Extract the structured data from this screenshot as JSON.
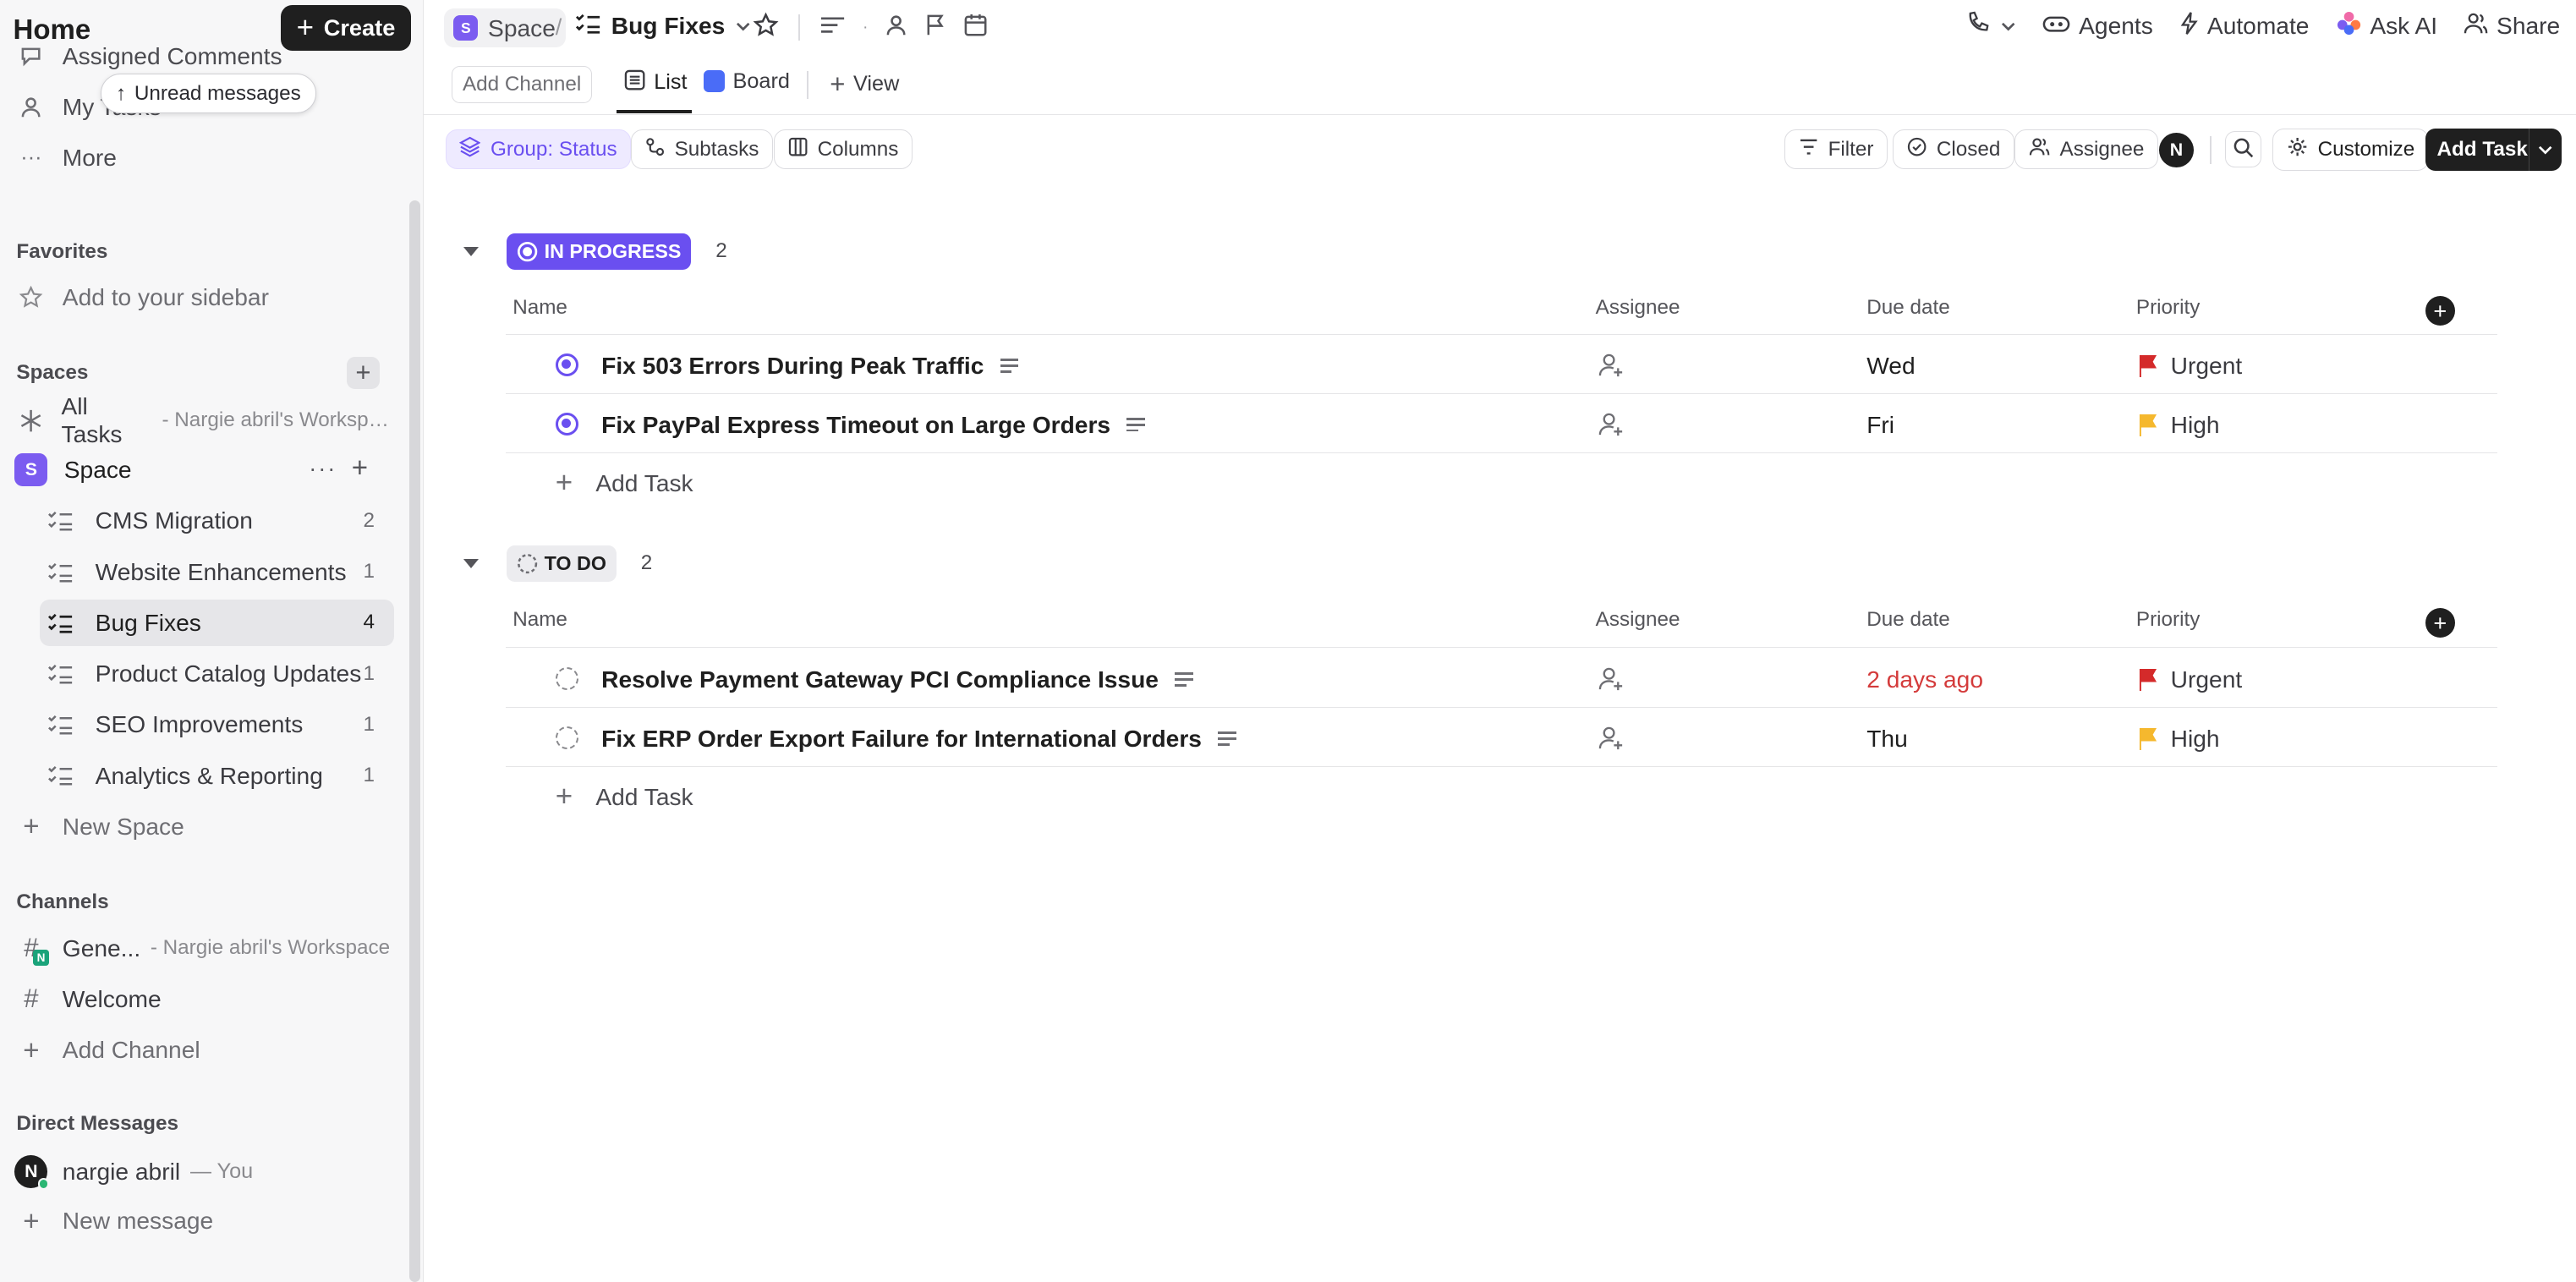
{
  "sidebar": {
    "title": "Home",
    "create_label": "Create",
    "top_items": [
      {
        "label": "Assigned Comments"
      },
      {
        "label": "My Tasks"
      },
      {
        "label": "More"
      }
    ],
    "unread_label": "Unread messages",
    "favorites": {
      "heading": "Favorites",
      "add_label": "Add to your sidebar"
    },
    "spaces": {
      "heading": "Spaces",
      "all_tasks": {
        "label": "All Tasks",
        "sub": "- Nargie abril's Workspace"
      },
      "space": {
        "badge": "S",
        "label": "Space"
      },
      "lists": [
        {
          "label": "CMS Migration",
          "count": "2"
        },
        {
          "label": "Website Enhancements",
          "count": "1"
        },
        {
          "label": "Bug Fixes",
          "count": "4"
        },
        {
          "label": "Product Catalog Updates",
          "count": "1"
        },
        {
          "label": "SEO Improvements",
          "count": "1"
        },
        {
          "label": "Analytics & Reporting",
          "count": "1"
        }
      ],
      "new_space_label": "New Space"
    },
    "channels": {
      "heading": "Channels",
      "items": [
        {
          "label": "Gene...",
          "sub": "- Nargie abril's Workspace"
        },
        {
          "label": "Welcome"
        }
      ],
      "add_label": "Add Channel"
    },
    "direct_messages": {
      "heading": "Direct Messages",
      "user": {
        "initial": "N",
        "name": "nargie abril",
        "suffix": "— You"
      },
      "new_label": "New message"
    }
  },
  "topbar": {
    "crumb_space": "Space",
    "crumb_separator": "/",
    "crumb_list": "Bug Fixes",
    "right": [
      {
        "label": "Agents",
        "icon": "agents-icon"
      },
      {
        "label": "Automate",
        "icon": "bolt-icon"
      },
      {
        "label": "Ask AI",
        "icon": "ai-icon"
      },
      {
        "label": "Share",
        "icon": "share-icon"
      }
    ]
  },
  "viewbar": {
    "add_channel": "Add Channel",
    "tabs": [
      {
        "label": "List",
        "active": true
      },
      {
        "label": "Board",
        "active": false
      }
    ],
    "add_view": "View"
  },
  "filters": {
    "group": "Group: Status",
    "subtasks": "Subtasks",
    "columns": "Columns",
    "filter": "Filter",
    "closed": "Closed",
    "assignee": "Assignee",
    "avatar": "N",
    "customize": "Customize",
    "add_task": "Add Task"
  },
  "columns": {
    "name": "Name",
    "assignee": "Assignee",
    "due": "Due date",
    "priority": "Priority"
  },
  "groups": [
    {
      "status": "IN PROGRESS",
      "count": "2",
      "tasks": [
        {
          "name": "Fix 503 Errors During Peak Traffic",
          "due": "Wed",
          "priority": "Urgent"
        },
        {
          "name": "Fix PayPal Express Timeout on Large Orders",
          "due": "Fri",
          "priority": "High"
        }
      ],
      "add_task": "Add Task"
    },
    {
      "status": "TO DO",
      "count": "2",
      "tasks": [
        {
          "name": "Resolve Payment Gateway PCI Compliance Issue",
          "due": "2 days ago",
          "priority": "Urgent"
        },
        {
          "name": "Fix ERP Order Export Failure for International Orders",
          "due": "Thu",
          "priority": "High"
        }
      ],
      "add_task": "Add Task"
    }
  ],
  "colors": {
    "accent": "#6a4ff0",
    "urgent": "#d42a2a",
    "high": "#f5b82e",
    "overdue": "#d43b3b"
  }
}
